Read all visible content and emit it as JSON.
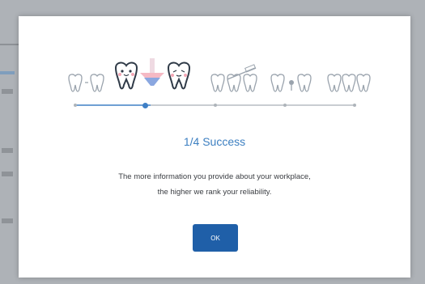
{
  "modal": {
    "progress": {
      "current_step": 1,
      "total_steps": 4,
      "step_count_including_start": 5,
      "fill_fraction": 0.27
    },
    "title": "1/4 Success",
    "message_line1": "The more information you provide about your workplace,",
    "message_line2": "the higher we rank your reliability.",
    "ok_label": "OK"
  },
  "colors": {
    "accent": "#3c7fc1",
    "button": "#1f5fa8",
    "tooth_outline": "#9aa3ad",
    "tooth_highlight": "#2f3a47",
    "cheek": "#f3a7b5",
    "funnel": "#8aa7e0"
  },
  "icons": [
    "tooth-icon",
    "funnel-icon",
    "brush-icon"
  ]
}
